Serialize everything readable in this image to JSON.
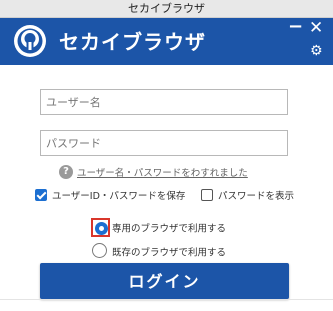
{
  "window": {
    "title": "セカイブラウザ"
  },
  "header": {
    "app_name": "セカイブラウザ",
    "minimize_glyph": "−",
    "close_glyph": "✕",
    "settings_glyph": "⚙",
    "logo_icon": "keyhole-logo-icon",
    "brand_color": "#1c55a8"
  },
  "form": {
    "username": {
      "value": "",
      "placeholder": "ユーザー名"
    },
    "password": {
      "value": "",
      "placeholder": "パスワード"
    },
    "help_glyph": "?",
    "forgot_label": "ユーザー名・パスワードをわすれました",
    "save_credentials": {
      "label": "ユーザーID・パスワードを保存",
      "checked": true
    },
    "show_password": {
      "label": "パスワードを表示",
      "checked": false
    },
    "browser_options": [
      {
        "label": "専用のブラウザで利用する",
        "selected": true
      },
      {
        "label": "既存のブラウザで利用する",
        "selected": false
      }
    ],
    "login_label": "ログイン"
  }
}
